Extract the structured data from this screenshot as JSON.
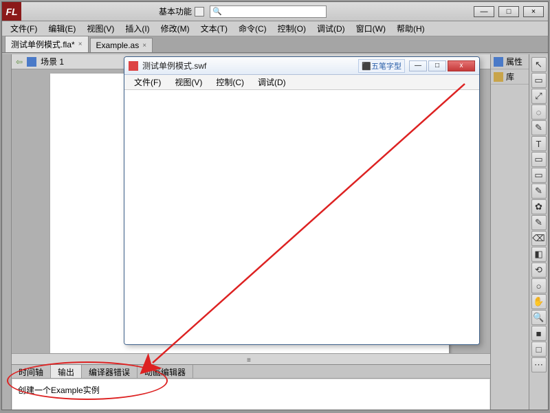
{
  "app": {
    "logo": "FL"
  },
  "title_center": {
    "label": "基本功能"
  },
  "window_controls": {
    "min": "—",
    "max": "□",
    "close": "×"
  },
  "menubar": [
    "文件(F)",
    "编辑(E)",
    "视图(V)",
    "插入(I)",
    "修改(M)",
    "文本(T)",
    "命令(C)",
    "控制(O)",
    "调试(D)",
    "窗口(W)",
    "帮助(H)"
  ],
  "doc_tabs": [
    {
      "label": "测试单例模式.fla*",
      "active": true
    },
    {
      "label": "Example.as",
      "active": false
    }
  ],
  "scene": {
    "name": "场景 1"
  },
  "right_panel": [
    {
      "label": "属性"
    },
    {
      "label": "库"
    }
  ],
  "tools": [
    "↖",
    "▭",
    "⤢",
    "◌",
    "✎",
    "T",
    "▭",
    "▭",
    "✎",
    "✿",
    "✎",
    "⌫",
    "◧",
    "⟲",
    "○",
    "✋",
    "🔍",
    "■",
    "□",
    "⋯"
  ],
  "bottom_tabs": [
    {
      "label": "时间轴",
      "active": false
    },
    {
      "label": "输出",
      "active": true
    },
    {
      "label": "编译器错误",
      "active": false
    },
    {
      "label": "动画编辑器",
      "active": false
    }
  ],
  "output_text": "创建一个Example实例",
  "swf": {
    "title": "测试单例模式.swf",
    "ime": "⬛五笔字型",
    "menubar": [
      "文件(F)",
      "视图(V)",
      "控制(C)",
      "调试(D)"
    ],
    "wb": {
      "min": "—",
      "max": "□",
      "close": "x"
    }
  }
}
